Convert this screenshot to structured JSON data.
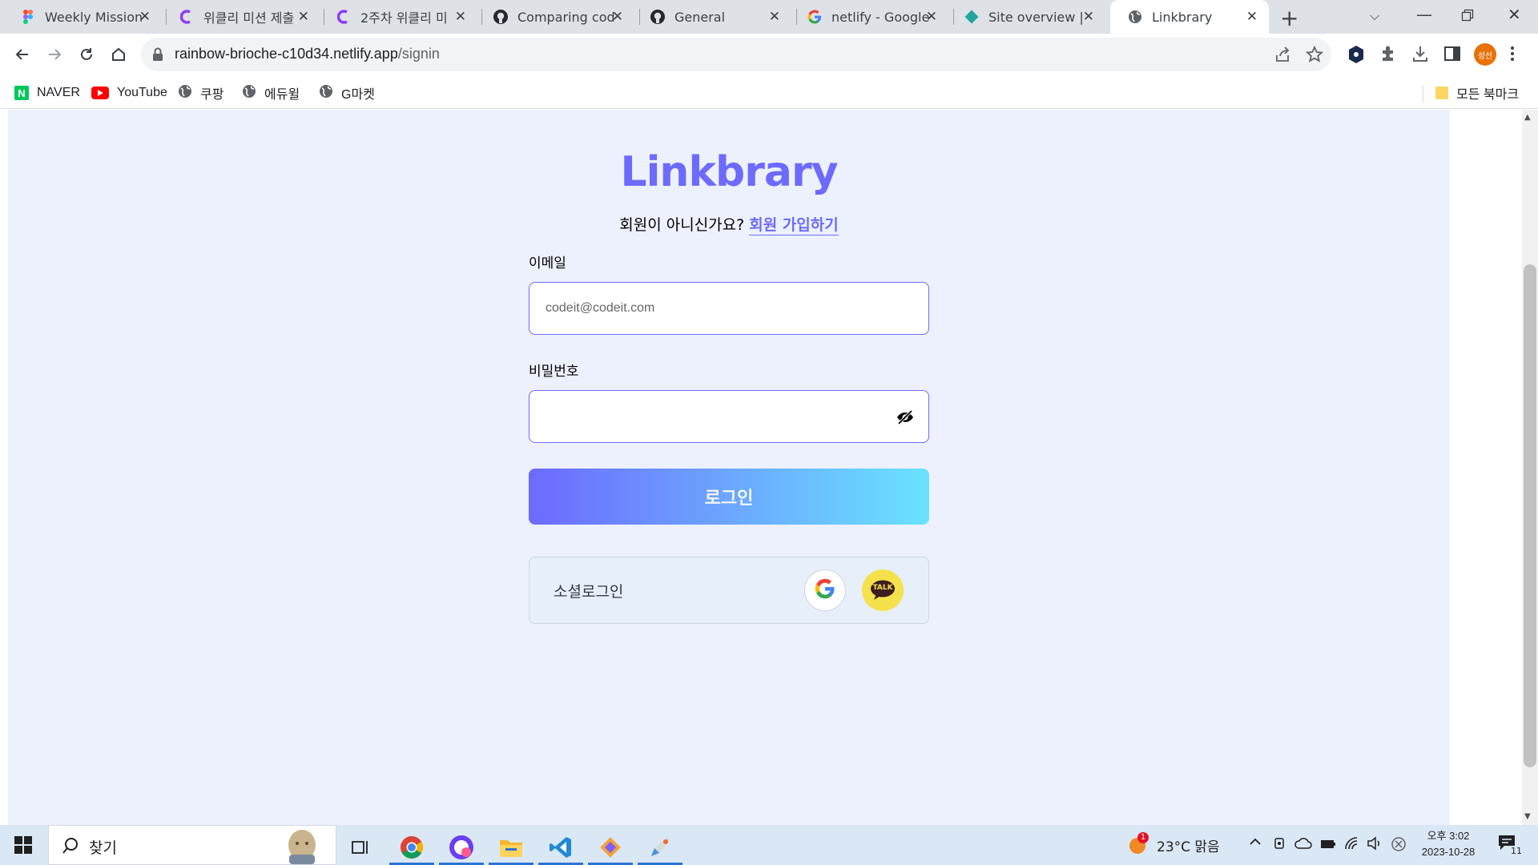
{
  "browser": {
    "tabs": [
      {
        "title": "Weekly Mission",
        "icon": "figma-icon"
      },
      {
        "title": "위클리 미션 제출",
        "icon": "codeit-icon"
      },
      {
        "title": "2주차 위클리 미",
        "icon": "codeit-icon"
      },
      {
        "title": "Comparing code",
        "icon": "github-icon"
      },
      {
        "title": "General",
        "icon": "github-icon"
      },
      {
        "title": "netlify - Google",
        "icon": "google-icon"
      },
      {
        "title": "Site overview | r",
        "icon": "netlify-icon"
      },
      {
        "title": "Linkbrary",
        "icon": "globe-icon"
      }
    ],
    "url_domain": "rainbow-brioche-c10d34.netlify.app",
    "url_path": "/signin",
    "profile_initials": "성선",
    "bookmarks": [
      {
        "label": "NAVER",
        "icon": "naver-icon"
      },
      {
        "label": "YouTube",
        "icon": "youtube-icon"
      },
      {
        "label": "쿠팡",
        "icon": "globe-icon"
      },
      {
        "label": "에듀윌",
        "icon": "globe-icon"
      },
      {
        "label": "G마켓",
        "icon": "globe-icon"
      }
    ],
    "all_bookmarks_label": "모든 북마크"
  },
  "page": {
    "logo_text": "Linkbrary",
    "signup_prompt": "회원이 아니신가요?",
    "signup_link": "회원 가입하기",
    "email_label": "이메일",
    "email_placeholder": "codeit@codeit.com",
    "password_label": "비밀번호",
    "password_value": "",
    "login_button": "로그인",
    "social_label": "소셜로그인",
    "kakao_label": "TALK",
    "brand_color": "#6d6afe",
    "gradient_end": "#6ae3fe",
    "background_color": "#edf1fd"
  },
  "taskbar": {
    "search_placeholder": "찾기",
    "weather": "23°C  맑음",
    "weather_badge": "1",
    "time": "오후 3:02",
    "date": "2023-10-28",
    "notification_count": "11"
  }
}
